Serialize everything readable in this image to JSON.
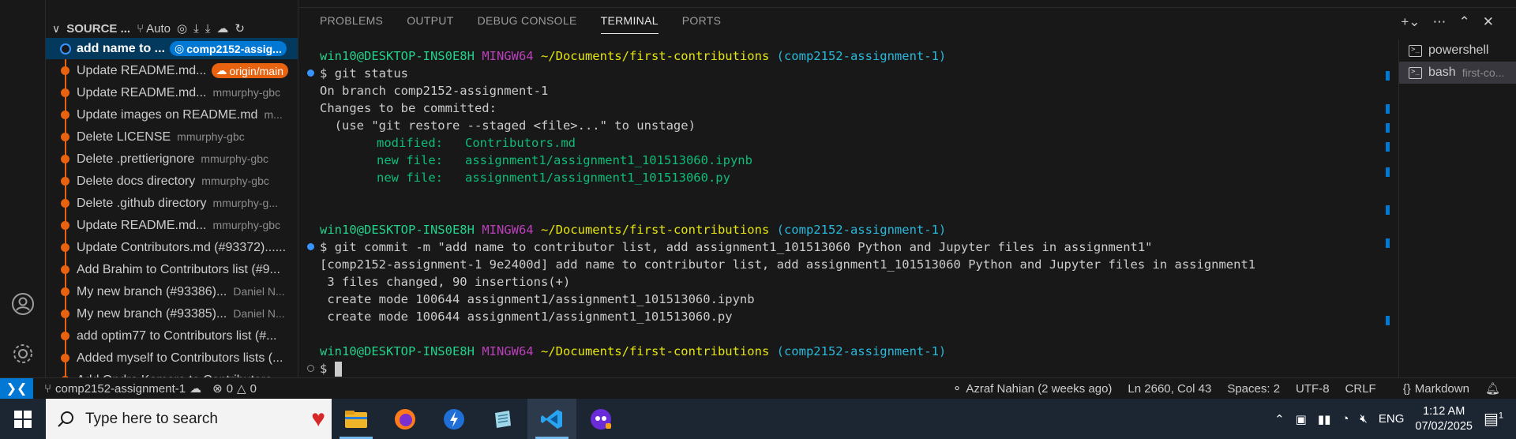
{
  "sidebar": {
    "title": "SOURCE ...",
    "auto_label": "Auto",
    "commits": [
      {
        "message": "add name to ...",
        "author": "",
        "badge": "comp2152-assig...",
        "badge_color": "#0078d4",
        "active": true
      },
      {
        "message": "Update README.md...",
        "author": "",
        "badge": "origin/main",
        "badge_color": "#e8620f",
        "active": false
      },
      {
        "message": "Update README.md...",
        "author": "mmurphy-gbc",
        "badge": "",
        "active": false
      },
      {
        "message": "Update images on README.md",
        "author": "m...",
        "badge": "",
        "active": false
      },
      {
        "message": "Delete LICENSE",
        "author": "mmurphy-gbc",
        "badge": "",
        "active": false
      },
      {
        "message": "Delete .prettierignore",
        "author": "mmurphy-gbc",
        "badge": "",
        "active": false
      },
      {
        "message": "Delete docs directory",
        "author": "mmurphy-gbc",
        "badge": "",
        "active": false
      },
      {
        "message": "Delete .github directory",
        "author": "mmurphy-g...",
        "badge": "",
        "active": false
      },
      {
        "message": "Update README.md...",
        "author": "mmurphy-gbc",
        "badge": "",
        "active": false
      },
      {
        "message": "Update Contributors.md (#93372)......",
        "author": "",
        "badge": "",
        "active": false
      },
      {
        "message": "Add Brahim to Contributors list (#9...",
        "author": "",
        "badge": "",
        "active": false
      },
      {
        "message": "My new branch (#93386)...",
        "author": "Daniel N...",
        "badge": "",
        "active": false
      },
      {
        "message": "My new branch (#93385)...",
        "author": "Daniel N...",
        "badge": "",
        "active": false
      },
      {
        "message": "add optim77 to Contributors list (#...",
        "author": "",
        "badge": "",
        "active": false
      },
      {
        "message": "Added myself to Contributors lists (...",
        "author": "",
        "badge": "",
        "active": false
      },
      {
        "message": "Add Ondra Komora to Contributors...",
        "author": "",
        "badge": "",
        "active": false
      }
    ]
  },
  "panel": {
    "tabs": [
      {
        "label": "PROBLEMS",
        "active": false
      },
      {
        "label": "OUTPUT",
        "active": false
      },
      {
        "label": "DEBUG CONSOLE",
        "active": false
      },
      {
        "label": "TERMINAL",
        "active": true
      },
      {
        "label": "PORTS",
        "active": false
      }
    ]
  },
  "terminal": {
    "prompt": {
      "user_host": "win10@DESKTOP-INS0E8H",
      "shell": "MINGW64",
      "path": "~/Documents/first-contributions",
      "branch": "(comp2152-assignment-1)",
      "symbol": "$"
    },
    "cmd1": "git status",
    "status_lines": [
      "On branch comp2152-assignment-1",
      "Changes to be committed:",
      "  (use \"git restore --staged <file>...\" to unstage)"
    ],
    "staged": [
      {
        "kind": "modified:",
        "file": "Contributors.md"
      },
      {
        "kind": "new file:",
        "file": "assignment1/assignment1_101513060.ipynb"
      },
      {
        "kind": "new file:",
        "file": "assignment1/assignment1_101513060.py"
      }
    ],
    "cmd2": "git commit -m \"add name to contributor list, add assignment1_101513060 Python and Jupyter files in assignment1\"",
    "commit_output": [
      "[comp2152-assignment-1 9e2400d] add name to contributor list, add assignment1_101513060 Python and Jupyter files in assignment1",
      " 3 files changed, 90 insertions(+)",
      " create mode 100644 assignment1/assignment1_101513060.ipynb",
      " create mode 100644 assignment1/assignment1_101513060.py"
    ]
  },
  "terminal_list": [
    {
      "name": "powershell",
      "sub": "",
      "active": false
    },
    {
      "name": "bash",
      "sub": "first-co...",
      "active": true
    }
  ],
  "statusbar": {
    "branch": "comp2152-assignment-1",
    "errors": "0",
    "warnings": "0",
    "blame": "Azraf Nahian (2 weeks ago)",
    "position": "Ln 2660, Col 43",
    "spaces": "Spaces: 2",
    "encoding": "UTF-8",
    "eol": "CRLF",
    "language": "Markdown"
  },
  "taskbar": {
    "search_placeholder": "Type here to search",
    "lang": "ENG",
    "time": "1:12 AM",
    "date": "07/02/2025",
    "notif_count": "1"
  }
}
